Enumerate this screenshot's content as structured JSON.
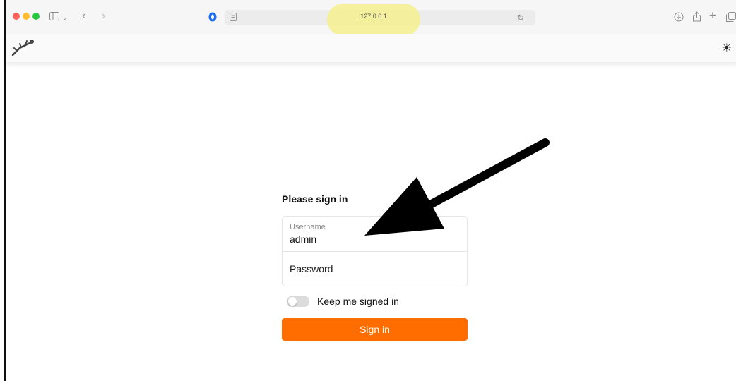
{
  "browser": {
    "url": "127.0.0.1",
    "icons": [
      "sidebar-icon",
      "chevron-down-icon",
      "back-icon",
      "forward-icon",
      "shield-icon",
      "reader-icon",
      "reload-icon",
      "download-icon",
      "share-icon",
      "new-tab-icon",
      "tabs-icon"
    ]
  },
  "header": {
    "logo_icon": "diver-logo-icon",
    "theme_icon": "sun-icon"
  },
  "login": {
    "title": "Please sign in",
    "username_label": "Username",
    "username_value": "admin",
    "password_placeholder": "Password",
    "keep_signed_in_label": "Keep me signed in",
    "keep_signed_in": false,
    "submit_label": "Sign in"
  },
  "colors": {
    "accent": "#ff6d00",
    "url_highlight": "#f5f08f"
  }
}
